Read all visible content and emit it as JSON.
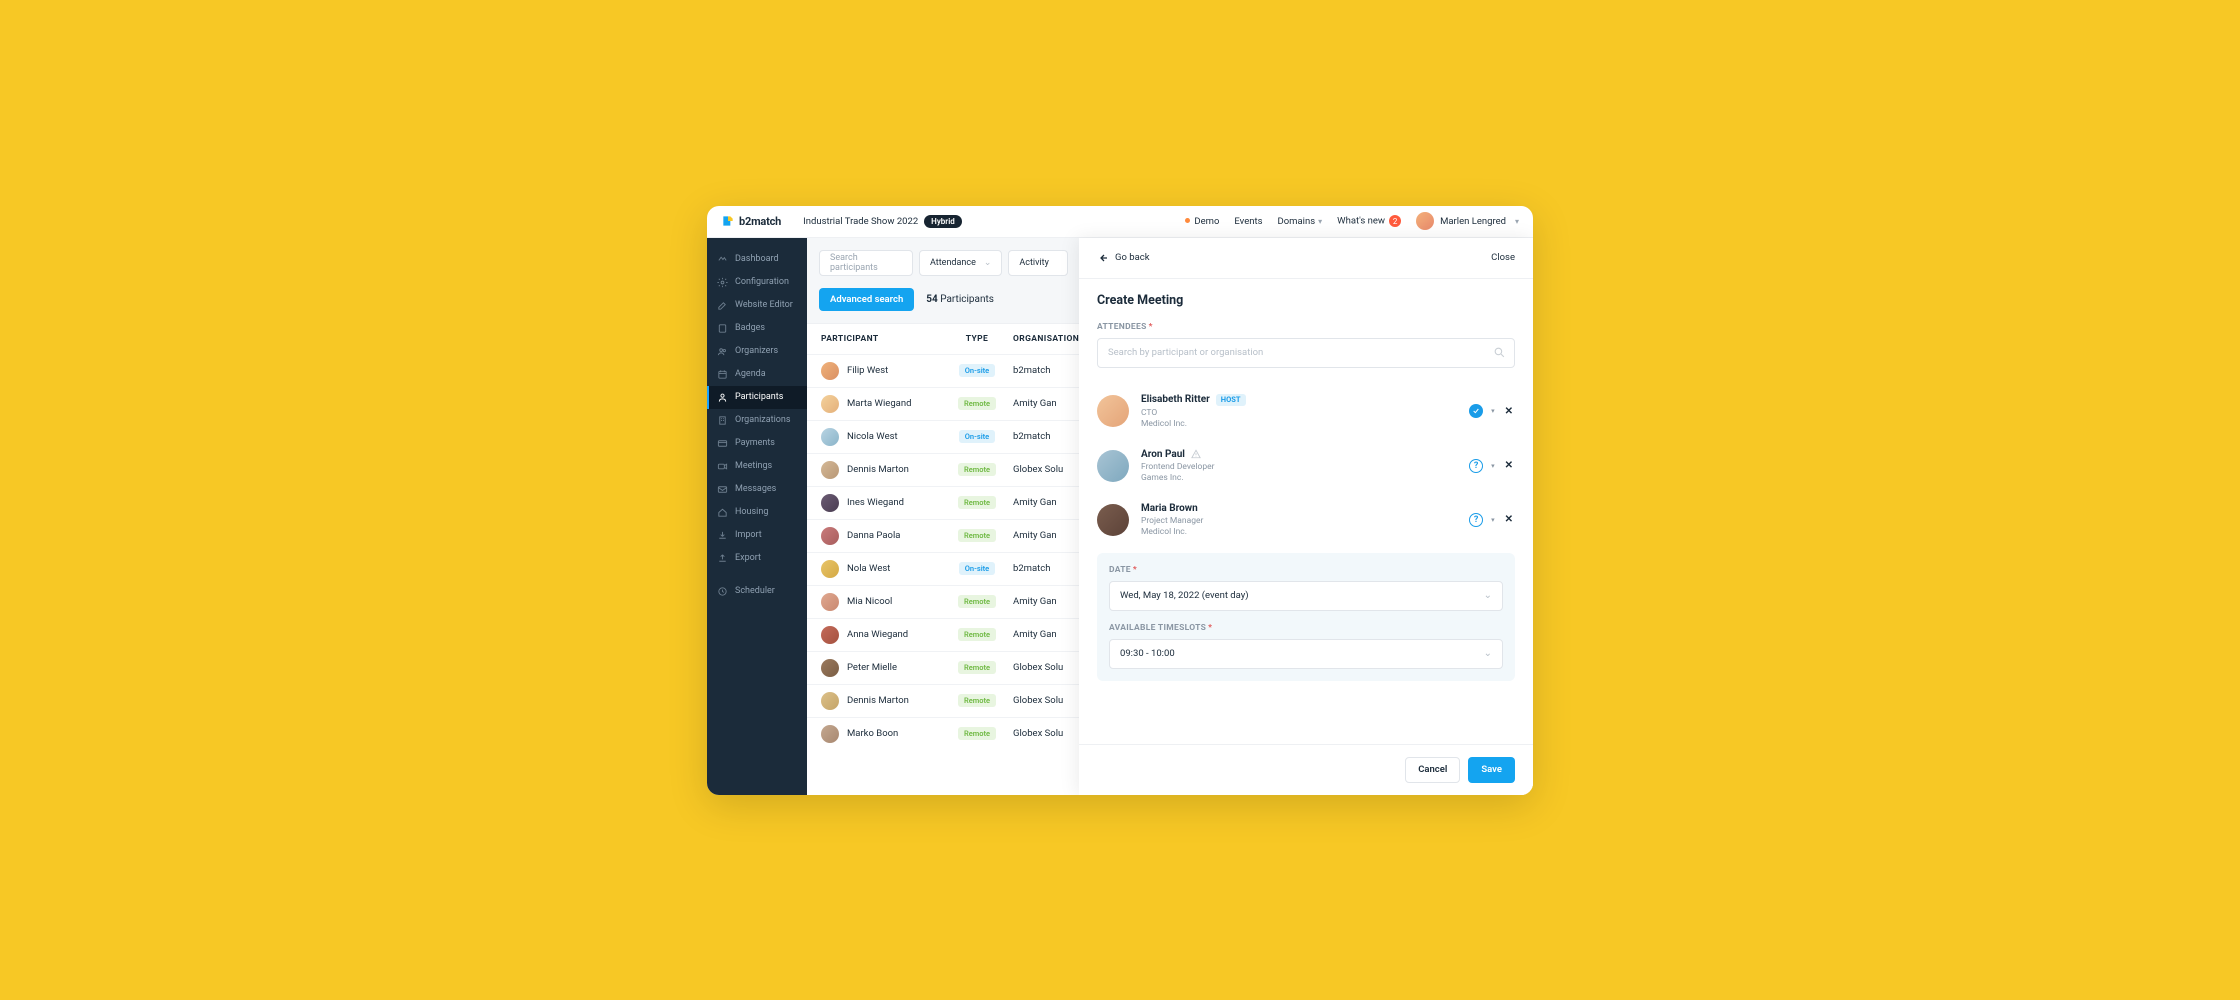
{
  "brand": "b2match",
  "event_title": "Industrial Trade Show 2022",
  "event_badge": "Hybrid",
  "topnav": {
    "demo": "Demo",
    "events": "Events",
    "domains": "Domains",
    "whatsnew": "What's new",
    "notif_count": "2",
    "user": "Marlen Lengred"
  },
  "sidebar": [
    {
      "icon": "dashboard",
      "label": "Dashboard"
    },
    {
      "icon": "gear",
      "label": "Configuration"
    },
    {
      "icon": "edit",
      "label": "Website Editor"
    },
    {
      "icon": "badge",
      "label": "Badges"
    },
    {
      "icon": "users",
      "label": "Organizers"
    },
    {
      "icon": "calendar",
      "label": "Agenda"
    },
    {
      "icon": "user",
      "label": "Participants",
      "active": true
    },
    {
      "icon": "building",
      "label": "Organizations"
    },
    {
      "icon": "card",
      "label": "Payments"
    },
    {
      "icon": "meet",
      "label": "Meetings"
    },
    {
      "icon": "mail",
      "label": "Messages"
    },
    {
      "icon": "house",
      "label": "Housing"
    },
    {
      "icon": "import",
      "label": "Import"
    },
    {
      "icon": "export",
      "label": "Export"
    },
    {
      "gap": true
    },
    {
      "icon": "clock",
      "label": "Scheduler"
    }
  ],
  "filters": {
    "search_placeholder": "Search participants",
    "attendance_label": "Attendance",
    "activity_label": "Activity"
  },
  "advanced_label": "Advanced search",
  "count_num": "54",
  "count_label": "Participants",
  "columns": {
    "participant": "PARTICIPANT",
    "type": "TYPE",
    "org": "ORGANISATION"
  },
  "rows": [
    {
      "name": "Filip West",
      "type": "On-site",
      "org": "b2match",
      "av": "av1",
      "pill": "onsite"
    },
    {
      "name": "Marta Wiegand",
      "type": "Remote",
      "org": "Amity Gan",
      "av": "av2",
      "pill": "remote"
    },
    {
      "name": "Nicola West",
      "type": "On-site",
      "org": "b2match",
      "av": "av3",
      "pill": "onsite"
    },
    {
      "name": "Dennis Marton",
      "type": "Remote",
      "org": "Globex Solu",
      "av": "av4",
      "pill": "remote"
    },
    {
      "name": "Ines Wiegand",
      "type": "Remote",
      "org": "Amity Gan",
      "av": "av5",
      "pill": "remote"
    },
    {
      "name": "Danna Paola",
      "type": "Remote",
      "org": "Amity Gan",
      "av": "av6",
      "pill": "remote"
    },
    {
      "name": "Nola West",
      "type": "On-site",
      "org": "b2match",
      "av": "av7",
      "pill": "onsite"
    },
    {
      "name": "Mia Nicool",
      "type": "Remote",
      "org": "Amity Gan",
      "av": "av8",
      "pill": "remote"
    },
    {
      "name": "Anna Wiegand",
      "type": "Remote",
      "org": "Amity Gan",
      "av": "av9",
      "pill": "remote"
    },
    {
      "name": "Peter Mielle",
      "type": "Remote",
      "org": "Globex Solu",
      "av": "av10",
      "pill": "remote"
    },
    {
      "name": "Dennis Marton",
      "type": "Remote",
      "org": "Globex Solu",
      "av": "av11",
      "pill": "remote"
    },
    {
      "name": "Marko Boon",
      "type": "Remote",
      "org": "Globex Solu",
      "av": "av12",
      "pill": "remote"
    }
  ],
  "panel": {
    "go_back": "Go back",
    "close": "Close",
    "title": "Create Meeting",
    "attendees_label": "ATTENDEES",
    "search_placeholder": "Search by participant or organisation",
    "attendees": [
      {
        "name": "Elisabeth Ritter",
        "host": true,
        "role": "CTO",
        "org": "Medicol Inc.",
        "status": "ok",
        "av": "aa1"
      },
      {
        "name": "Aron Paul",
        "warn": true,
        "role": "Frontend Developer",
        "org": "Games Inc.",
        "status": "q",
        "av": "aa2"
      },
      {
        "name": "Maria Brown",
        "role": "Project Manager",
        "org": "Medicol Inc.",
        "status": "q",
        "av": "aa3"
      }
    ],
    "date_label": "DATE",
    "date_value": "Wed, May 18, 2022 (event day)",
    "timeslot_label": "AVAILABLE TIMESLOTS",
    "timeslot_value": "09:30 - 10:00",
    "cancel": "Cancel",
    "save": "Save",
    "host_label": "HOST"
  }
}
